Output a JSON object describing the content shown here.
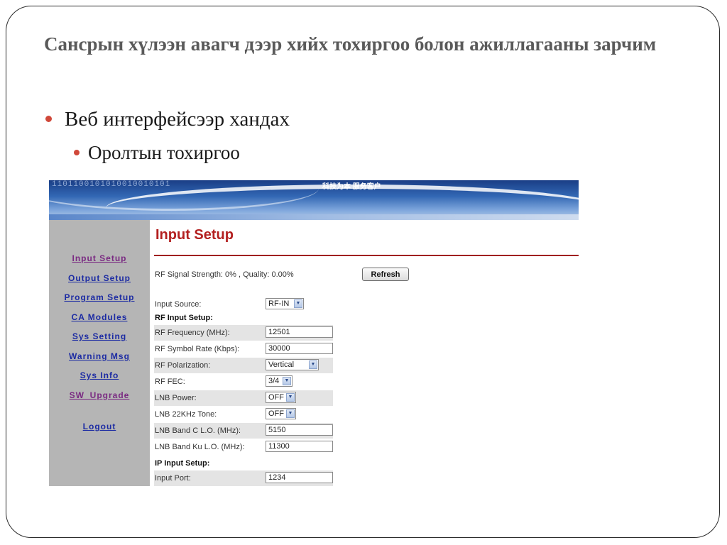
{
  "slide": {
    "title": "Сансрын хүлээн авагч дээр хийх тохиргоо болон ажиллагааны зарчим",
    "bullets": [
      "Веб интерфейсээр хандах",
      "Оролтын тохиргоо"
    ]
  },
  "banner": {
    "binary": "1101100101010010010101",
    "slogan": "科技为本 服务客户"
  },
  "nav": {
    "items": [
      "Input Setup",
      "Output Setup",
      "Program Setup",
      "CA Modules",
      "Sys Setting",
      "Warning Msg",
      "Sys Info",
      "SW_Upgrade",
      "Logout"
    ],
    "active_index": 0
  },
  "main": {
    "heading": "Input Setup",
    "status": "RF Signal Strength: 0% , Quality: 0.00%",
    "refresh_label": "Refresh",
    "input_source": {
      "label": "Input Source:",
      "value": "RF-IN"
    },
    "rf_section": "RF Input Setup:",
    "rf_fields": [
      {
        "label": "RF Frequency (MHz):",
        "value": "12501",
        "kind": "input"
      },
      {
        "label": "RF Symbol Rate (Kbps):",
        "value": "30000",
        "kind": "input"
      },
      {
        "label": "RF Polarization:",
        "value": "Vertical",
        "kind": "select"
      },
      {
        "label": "RF FEC:",
        "value": "3/4",
        "kind": "select"
      },
      {
        "label": "LNB Power:",
        "value": "OFF",
        "kind": "select"
      },
      {
        "label": "LNB 22KHz Tone:",
        "value": "OFF",
        "kind": "select"
      },
      {
        "label": "LNB Band C L.O. (MHz):",
        "value": "5150",
        "kind": "input"
      },
      {
        "label": "LNB Band Ku L.O. (MHz):",
        "value": "11300",
        "kind": "input"
      }
    ],
    "ip_section": "IP Input Setup:",
    "ip_fields": [
      {
        "label": "Input Port:",
        "value": "1234",
        "kind": "input"
      }
    ]
  },
  "colors": {
    "heading": "#b32020",
    "nav_link": "#1c2ba3",
    "nav_active": "#7a2a82",
    "bullet": "#d0483a"
  }
}
